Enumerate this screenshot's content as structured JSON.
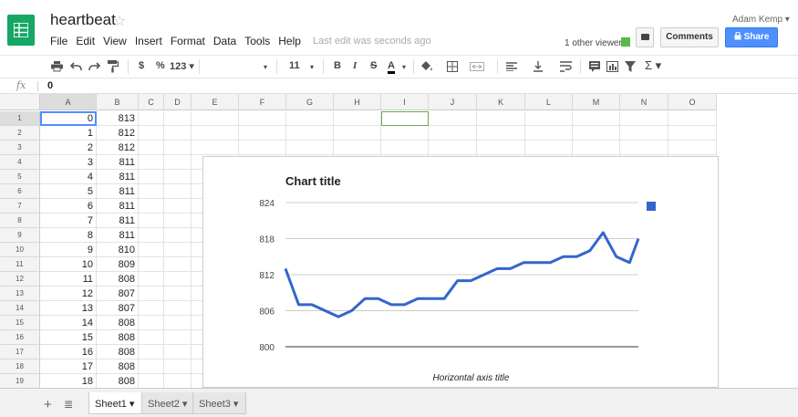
{
  "doc": {
    "title": "heartbeat",
    "star": "☆"
  },
  "menu": [
    "File",
    "Edit",
    "View",
    "Insert",
    "Format",
    "Data",
    "Tools",
    "Help"
  ],
  "last_edit": "Last edit was seconds ago",
  "collab": {
    "viewer_text": "1 other viewer",
    "viewer_color": "#56bb48"
  },
  "buttons": {
    "comments": "Comments",
    "share": "Share"
  },
  "user": "Adam Kemp ▾",
  "toolbar": {
    "currency": "$",
    "percent": "%",
    "format_more": "123 ▾",
    "font_dropdown": "▾",
    "font_size": "11",
    "font_size_arrow": "▾",
    "bold": "B",
    "italic": "I",
    "strike": "S",
    "text_color": "A",
    "sigma": "Σ ▾"
  },
  "formula": {
    "fx": "fx",
    "value": "0"
  },
  "columns": [
    "A",
    "B",
    "C",
    "D",
    "E",
    "F",
    "G",
    "H",
    "I",
    "J",
    "K",
    "L",
    "M",
    "N",
    "O"
  ],
  "rows": [
    {
      "n": "1",
      "a": "0",
      "b": "813"
    },
    {
      "n": "2",
      "a": "1",
      "b": "812"
    },
    {
      "n": "3",
      "a": "2",
      "b": "812"
    },
    {
      "n": "4",
      "a": "3",
      "b": "811"
    },
    {
      "n": "5",
      "a": "4",
      "b": "811"
    },
    {
      "n": "6",
      "a": "5",
      "b": "811"
    },
    {
      "n": "7",
      "a": "6",
      "b": "811"
    },
    {
      "n": "8",
      "a": "7",
      "b": "811"
    },
    {
      "n": "9",
      "a": "8",
      "b": "811"
    },
    {
      "n": "10",
      "a": "9",
      "b": "810"
    },
    {
      "n": "11",
      "a": "10",
      "b": "809"
    },
    {
      "n": "12",
      "a": "11",
      "b": "808"
    },
    {
      "n": "13",
      "a": "12",
      "b": "807"
    },
    {
      "n": "14",
      "a": "13",
      "b": "807"
    },
    {
      "n": "15",
      "a": "14",
      "b": "808"
    },
    {
      "n": "16",
      "a": "15",
      "b": "808"
    },
    {
      "n": "17",
      "a": "16",
      "b": "808"
    },
    {
      "n": "18",
      "a": "17",
      "b": "808"
    },
    {
      "n": "19",
      "a": "18",
      "b": "808"
    }
  ],
  "sheets": [
    "Sheet1 ▾",
    "Sheet2 ▾",
    "Sheet3 ▾"
  ],
  "chart_data": {
    "type": "line",
    "title": "Chart title",
    "xlabel": "Horizontal axis title",
    "ylabel": "",
    "yticks": [
      "824",
      "818",
      "812",
      "806",
      "800"
    ],
    "ylim": [
      800,
      824
    ],
    "color": "#3366cc",
    "x": [
      0,
      30,
      60,
      90,
      120,
      150,
      180,
      210,
      240,
      270,
      300,
      330,
      360,
      390,
      420,
      450,
      480,
      510,
      540,
      570,
      600,
      630,
      660,
      690,
      720,
      750,
      780,
      800
    ],
    "values": [
      813,
      807,
      807,
      806,
      805,
      806,
      808,
      808,
      807,
      807,
      808,
      808,
      808,
      811,
      811,
      812,
      813,
      813,
      814,
      814,
      814,
      815,
      815,
      816,
      819,
      815,
      814,
      818
    ]
  }
}
